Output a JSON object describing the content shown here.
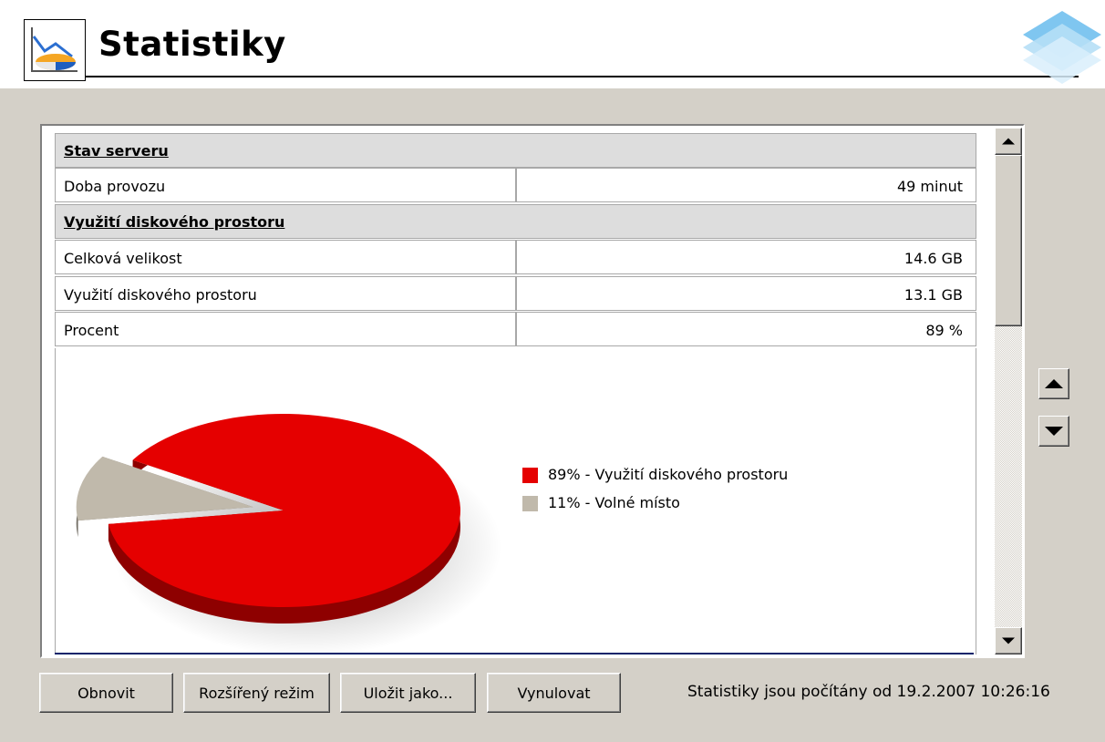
{
  "header": {
    "title": "Statistiky",
    "icon": "statistics-chart-icon"
  },
  "table": {
    "server_section": "Stav serveru",
    "uptime_label": "Doba provozu",
    "uptime_value": "49 minut",
    "disk_section": "Využití diskového prostoru",
    "rows": [
      {
        "label": "Celková velikost",
        "value": "14.6 GB"
      },
      {
        "label": "Využití diskového prostoru",
        "value": "13.1 GB"
      },
      {
        "label": "Procent",
        "value": "89 %"
      }
    ]
  },
  "chart_data": {
    "type": "pie",
    "title": "",
    "slices": [
      {
        "label": "89% - Využití diskového prostoru",
        "value": 89,
        "color": "#e50000"
      },
      {
        "label": "11% - Volné místo",
        "value": 11,
        "color": "#c0b9ab"
      }
    ],
    "legend": "right"
  },
  "buttons": {
    "refresh": "Obnovit",
    "advanced": "Rozšířený režim",
    "save_as": "Uložit jako...",
    "reset": "Vynulovat"
  },
  "status": "Statistiky jsou počítány od 19.2.2007 10:26:16",
  "colors": {
    "used": "#e50000",
    "free": "#c0b9ab",
    "dialog_bg": "#d4d0c8"
  }
}
